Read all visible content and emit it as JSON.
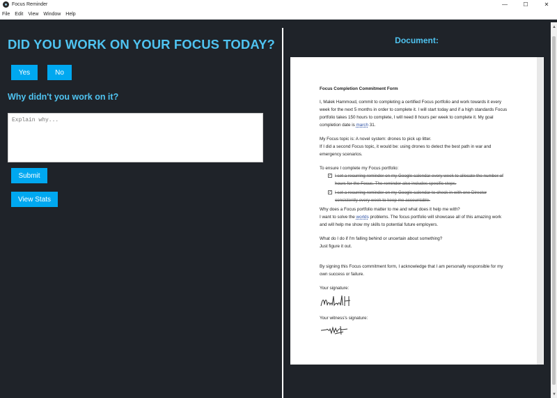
{
  "window": {
    "title": "Focus Reminder",
    "controls": [
      "—",
      "☐",
      "✕"
    ]
  },
  "menu": [
    "File",
    "Edit",
    "View",
    "Window",
    "Help"
  ],
  "left": {
    "question": "DID YOU WORK ON YOUR FOCUS TODAY?",
    "yes_label": "Yes",
    "no_label": "No",
    "why_label": "Why didn't you work on it?",
    "explain_placeholder": "Explain why...",
    "submit_label": "Submit",
    "stats_label": "View Stats"
  },
  "right": {
    "heading": "Document:",
    "doc": {
      "title": "Focus Completion Commitment Form",
      "p1_a": "I, Malek Hammoud, commit to completing a certified Focus portfolio and work towards it every week for the next 5 months in order to complete it. I will start today and if a high standards Focus portfolio takes 150 hours to complete, I will need 8 hours per week to complete it. My goal completion date is ",
      "p1_link": "march",
      "p1_b": " 31.",
      "p2_line1": "My Focus topic is: A novel system: drones to pick up litter.",
      "p2_line2": "If I did a second Focus topic, it would be: using drones to detect the best path in war and emergency scenarios.",
      "ensure_label": "To ensure I complete my Focus portfolio:",
      "check1": "I set a recurring reminder on my Google calendar every week to allocate the number of hours for the Focus. The reminder also includes specific steps.",
      "check2": "I set a recurring reminder on my Google calendar to check in with one Director consistently every week to keep me accountable.",
      "p4_q": "Why does a Focus portfolio matter to me and what does it help me with?",
      "p4_a1": "I want to solve the ",
      "p4_link": "worlds",
      "p4_a2": " problems. The focus portfolio will showcase all of this amazing work and will help me show my skills to potential future employers.",
      "p5_q": "What do I do if I'm falling behind or uncertain about something?",
      "p5_a": "Just figure it out.",
      "p6": "By signing this Focus commitment form, I acknowledge that I am personally responsible for my own success or failure.",
      "sig_label": "Your signature:",
      "sig_text": "Malek H",
      "witness_label": "Your witness's signature:"
    }
  },
  "colors": {
    "accent": "#4fc3f0",
    "button": "#00a8f0",
    "background": "#1f2329"
  }
}
